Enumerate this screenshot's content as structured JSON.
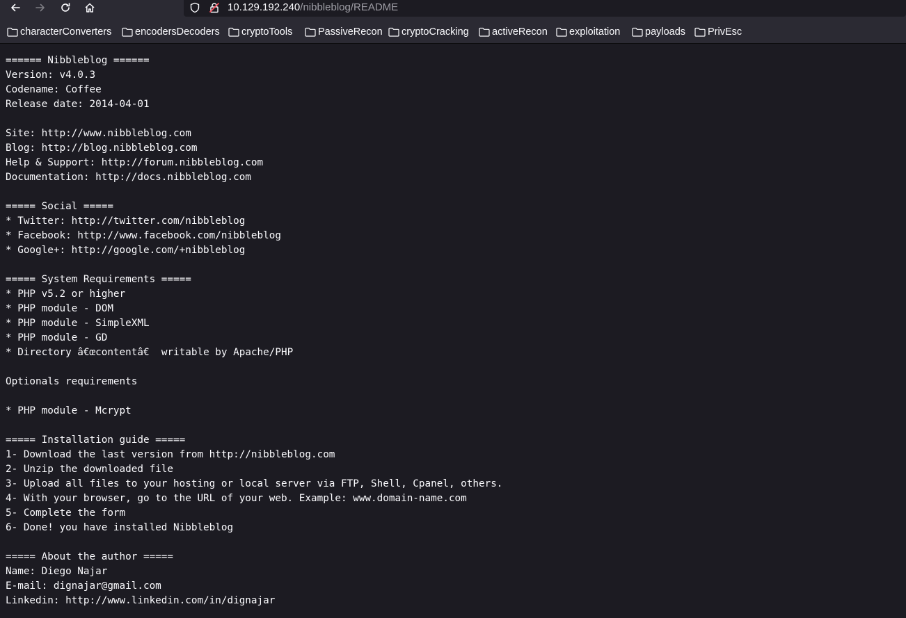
{
  "toolbar": {
    "back_icon": "arrow-left-icon",
    "forward_icon": "arrow-right-icon",
    "reload_icon": "reload-icon",
    "home_icon": "home-icon"
  },
  "urlbar": {
    "shield_icon": "shield-icon",
    "insecure_icon": "insecure-lock-icon",
    "host": "10.129.192.240",
    "path": "/nibbleblog/README"
  },
  "bookmarks": [
    {
      "label": "characterConverters"
    },
    {
      "label": "encodersDecoders"
    },
    {
      "label": "cryptoTools"
    },
    {
      "label": "PassiveRecon"
    },
    {
      "label": "cryptoCracking"
    },
    {
      "label": "activeRecon"
    },
    {
      "label": "exploitation"
    },
    {
      "label": "payloads"
    },
    {
      "label": "PrivEsc"
    }
  ],
  "document": {
    "lines": [
      "====== Nibbleblog ======",
      "Version: v4.0.3",
      "Codename: Coffee",
      "Release date: 2014-04-01",
      "",
      "Site: http://www.nibbleblog.com",
      "Blog: http://blog.nibbleblog.com",
      "Help & Support: http://forum.nibbleblog.com",
      "Documentation: http://docs.nibbleblog.com",
      "",
      "===== Social =====",
      "* Twitter: http://twitter.com/nibbleblog",
      "* Facebook: http://www.facebook.com/nibbleblog",
      "* Google+: http://google.com/+nibbleblog",
      "",
      "===== System Requirements =====",
      "* PHP v5.2 or higher",
      "* PHP module - DOM",
      "* PHP module - SimpleXML",
      "* PHP module - GD",
      "* Directory â€œcontentâ€ writable by Apache/PHP",
      "",
      "Optionals requirements",
      "",
      "* PHP module - Mcrypt",
      "",
      "===== Installation guide =====",
      "1- Download the last version from http://nibbleblog.com",
      "2- Unzip the downloaded file",
      "3- Upload all files to your hosting or local server via FTP, Shell, Cpanel, others.",
      "4- With your browser, go to the URL of your web. Example: www.domain-name.com",
      "5- Complete the form",
      "6- Done! you have installed Nibbleblog",
      "",
      "===== About the author =====",
      "Name: Diego Najar",
      "E-mail: dignajar@gmail.com",
      "Linkedin: http://www.linkedin.com/in/dignajar"
    ]
  }
}
